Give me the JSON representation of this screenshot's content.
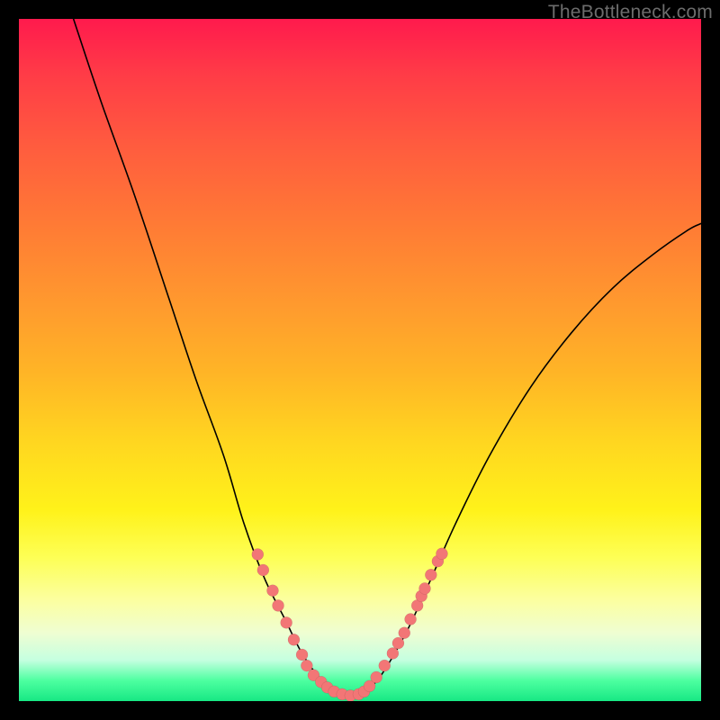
{
  "watermark": "TheBottleneck.com",
  "colors": {
    "background_frame": "#000000",
    "gradient_top": "#ff1a4d",
    "gradient_bottom": "#17e884",
    "curve": "#000000",
    "dot_fill": "#f27676"
  },
  "chart_data": {
    "type": "line",
    "title": "",
    "xlabel": "",
    "ylabel": "",
    "xlim": [
      0,
      1
    ],
    "ylim": [
      0,
      1
    ],
    "note": "Coordinates are normalized to the plot area (0 = left/top, 1 = right/bottom). The single black curve is a V-shape; scattered salmon dots cluster near the bottom of the V.",
    "series": [
      {
        "name": "v-curve",
        "kind": "line",
        "points": [
          {
            "x": 0.08,
            "y": 0.0
          },
          {
            "x": 0.12,
            "y": 0.12
          },
          {
            "x": 0.17,
            "y": 0.26
          },
          {
            "x": 0.22,
            "y": 0.41
          },
          {
            "x": 0.26,
            "y": 0.53
          },
          {
            "x": 0.3,
            "y": 0.64
          },
          {
            "x": 0.33,
            "y": 0.74
          },
          {
            "x": 0.36,
            "y": 0.82
          },
          {
            "x": 0.39,
            "y": 0.88
          },
          {
            "x": 0.415,
            "y": 0.93
          },
          {
            "x": 0.44,
            "y": 0.965
          },
          {
            "x": 0.465,
            "y": 0.985
          },
          {
            "x": 0.49,
            "y": 0.993
          },
          {
            "x": 0.505,
            "y": 0.988
          },
          {
            "x": 0.525,
            "y": 0.97
          },
          {
            "x": 0.545,
            "y": 0.94
          },
          {
            "x": 0.57,
            "y": 0.895
          },
          {
            "x": 0.6,
            "y": 0.83
          },
          {
            "x": 0.64,
            "y": 0.74
          },
          {
            "x": 0.69,
            "y": 0.64
          },
          {
            "x": 0.75,
            "y": 0.54
          },
          {
            "x": 0.81,
            "y": 0.46
          },
          {
            "x": 0.87,
            "y": 0.395
          },
          {
            "x": 0.93,
            "y": 0.345
          },
          {
            "x": 0.98,
            "y": 0.31
          },
          {
            "x": 1.0,
            "y": 0.3
          }
        ]
      },
      {
        "name": "dots-left-arm",
        "kind": "scatter",
        "points": [
          {
            "x": 0.35,
            "y": 0.785
          },
          {
            "x": 0.358,
            "y": 0.808
          },
          {
            "x": 0.372,
            "y": 0.838
          },
          {
            "x": 0.38,
            "y": 0.86
          },
          {
            "x": 0.392,
            "y": 0.885
          },
          {
            "x": 0.403,
            "y": 0.91
          },
          {
            "x": 0.415,
            "y": 0.932
          },
          {
            "x": 0.422,
            "y": 0.948
          },
          {
            "x": 0.432,
            "y": 0.962
          }
        ]
      },
      {
        "name": "dots-bottom",
        "kind": "scatter",
        "points": [
          {
            "x": 0.443,
            "y": 0.972
          },
          {
            "x": 0.452,
            "y": 0.98
          },
          {
            "x": 0.462,
            "y": 0.986
          },
          {
            "x": 0.474,
            "y": 0.99
          },
          {
            "x": 0.486,
            "y": 0.992
          },
          {
            "x": 0.498,
            "y": 0.99
          },
          {
            "x": 0.506,
            "y": 0.986
          },
          {
            "x": 0.514,
            "y": 0.978
          }
        ]
      },
      {
        "name": "dots-right-arm",
        "kind": "scatter",
        "points": [
          {
            "x": 0.524,
            "y": 0.965
          },
          {
            "x": 0.536,
            "y": 0.948
          },
          {
            "x": 0.548,
            "y": 0.93
          },
          {
            "x": 0.556,
            "y": 0.915
          },
          {
            "x": 0.565,
            "y": 0.9
          },
          {
            "x": 0.574,
            "y": 0.88
          },
          {
            "x": 0.584,
            "y": 0.86
          },
          {
            "x": 0.59,
            "y": 0.846
          },
          {
            "x": 0.595,
            "y": 0.835
          },
          {
            "x": 0.604,
            "y": 0.815
          },
          {
            "x": 0.614,
            "y": 0.795
          },
          {
            "x": 0.62,
            "y": 0.784
          }
        ]
      }
    ]
  }
}
